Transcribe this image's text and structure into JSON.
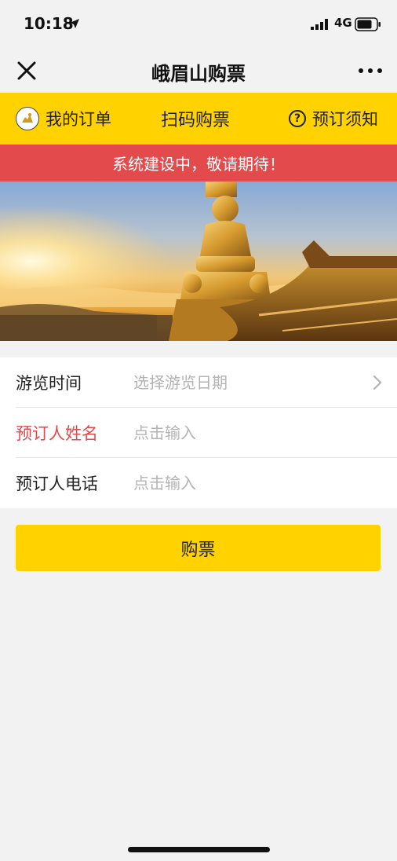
{
  "status_bar": {
    "time": "10:18",
    "network": "4G"
  },
  "nav": {
    "title": "峨眉山购票",
    "close_icon": "close-icon",
    "more_icon": "more-icon"
  },
  "toolbar": {
    "orders_label": "我的订单",
    "scan_label": "扫码购票",
    "notice_label": "预订须知",
    "notice_icon_glyph": "?"
  },
  "banner": {
    "text": "系统建设中，敬请期待！"
  },
  "hero": {
    "description_icon": "golden-buddha-photo"
  },
  "form": {
    "date_label": "游览时间",
    "date_placeholder": "选择游览日期",
    "name_label": "预订人姓名",
    "name_placeholder": "点击输入",
    "phone_label": "预订人电话",
    "phone_placeholder": "点击输入"
  },
  "buy_button": {
    "label": "购票"
  },
  "colors": {
    "brand_yellow": "#ffd200",
    "alert_red": "#e24a4b",
    "page_bg": "#f2f2f2"
  }
}
